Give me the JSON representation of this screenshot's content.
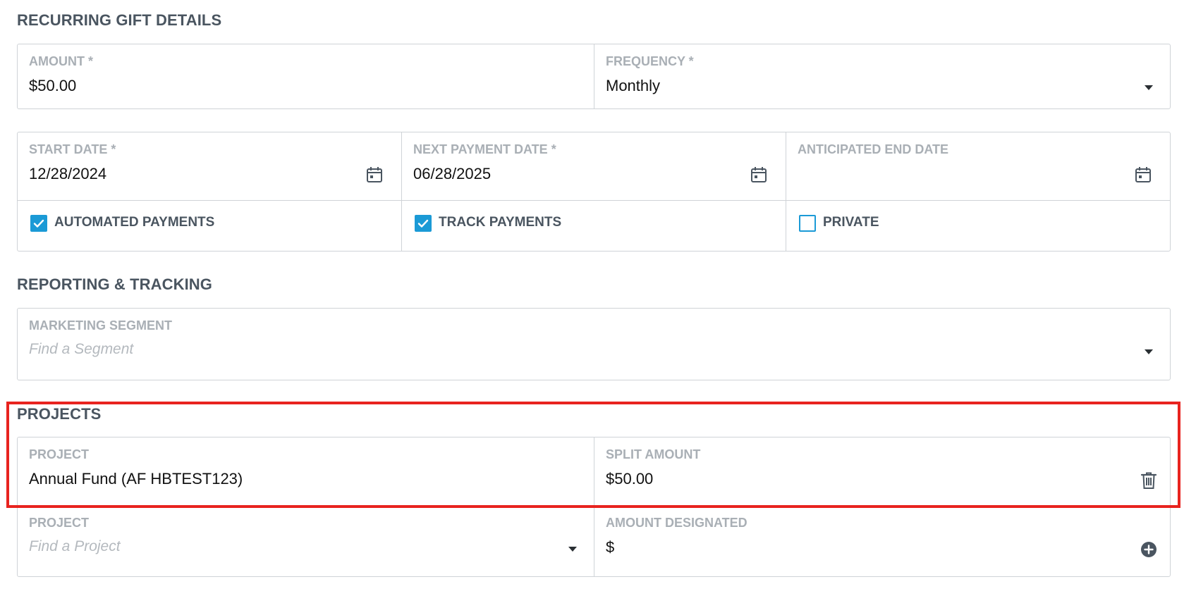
{
  "sections": {
    "recurring": "RECURRING GIFT DETAILS",
    "reporting": "REPORTING & TRACKING",
    "projects": "PROJECTS"
  },
  "amount": {
    "label": "AMOUNT  *",
    "value": "$50.00"
  },
  "frequency": {
    "label": "FREQUENCY *",
    "value": "Monthly"
  },
  "start_date": {
    "label": "START DATE *",
    "value": "12/28/2024"
  },
  "next_payment_date": {
    "label": "NEXT PAYMENT DATE *",
    "value": "06/28/2025"
  },
  "anticipated_end_date": {
    "label": "ANTICIPATED END DATE",
    "value": ""
  },
  "checkboxes": {
    "automated": {
      "label": "AUTOMATED PAYMENTS",
      "checked": true
    },
    "track": {
      "label": "TRACK PAYMENTS",
      "checked": true
    },
    "private": {
      "label": "PRIVATE",
      "checked": false
    }
  },
  "marketing_segment": {
    "label": "MARKETING SEGMENT",
    "placeholder": "Find a Segment"
  },
  "project_row": {
    "project_label": "PROJECT",
    "project_value": "Annual Fund  (AF HBTEST123)",
    "split_label": "SPLIT AMOUNT",
    "split_value": "$50.00"
  },
  "new_project_row": {
    "project_label": "PROJECT",
    "project_placeholder": "Find a Project",
    "amount_label": "AMOUNT DESIGNATED",
    "amount_prefix": "$"
  },
  "colors": {
    "accent": "#1b9ad6",
    "highlight": "#e8231f",
    "heading": "#4a5560"
  },
  "icons": [
    "calendar-icon",
    "chevron-down-icon",
    "trash-icon",
    "add-circle-icon",
    "checkbox-checked-icon"
  ]
}
